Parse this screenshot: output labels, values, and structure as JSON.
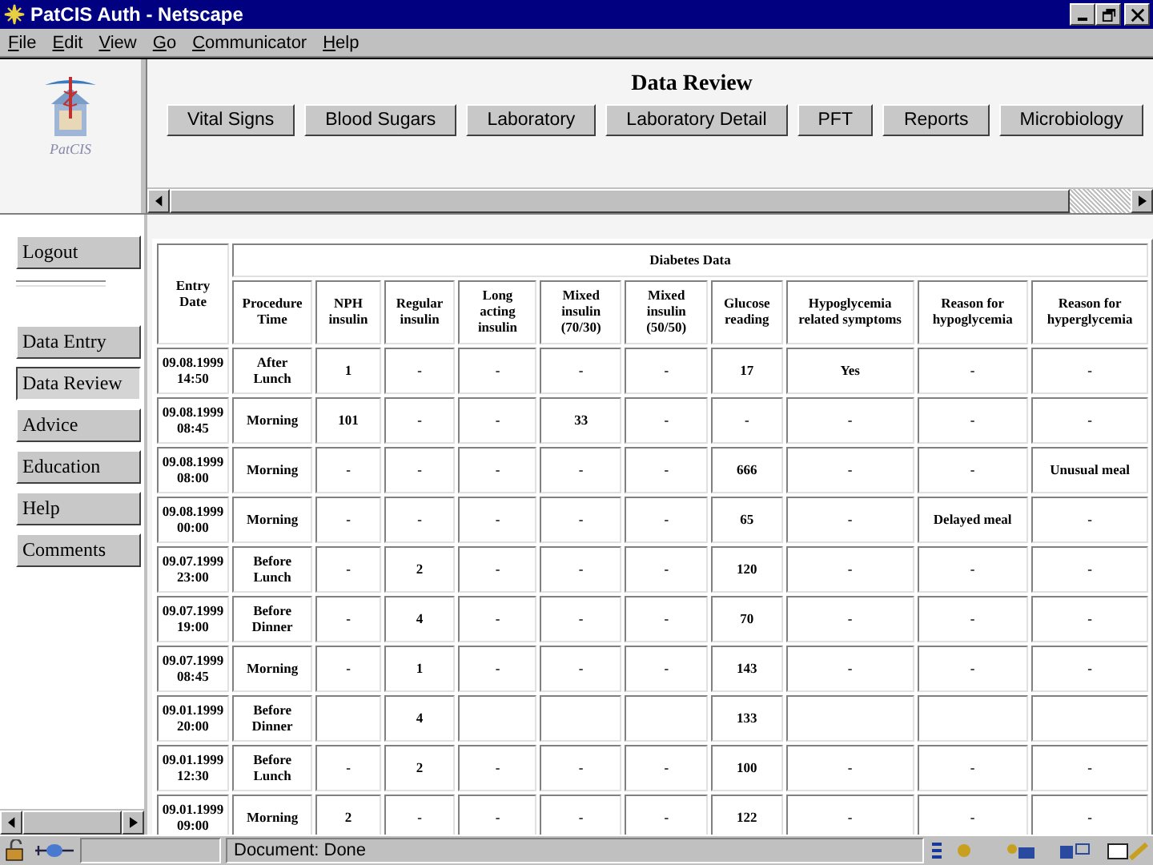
{
  "window": {
    "title": "PatCIS Auth - Netscape"
  },
  "menu": [
    "File",
    "Edit",
    "View",
    "Go",
    "Communicator",
    "Help"
  ],
  "logo": {
    "text": "PatCIS"
  },
  "header": {
    "title": "Data Review",
    "nav_buttons": [
      "Vital Signs",
      "Blood Sugars",
      "Laboratory",
      "Laboratory Detail",
      "PFT",
      "Reports",
      "Microbiology"
    ]
  },
  "sidebar": {
    "top_button": "Logout",
    "items": [
      {
        "label": "Data Entry",
        "selected": false
      },
      {
        "label": "Data Review",
        "selected": true
      },
      {
        "label": "Advice",
        "selected": false
      },
      {
        "label": "Education",
        "selected": false
      },
      {
        "label": "Help",
        "selected": false
      },
      {
        "label": "Comments",
        "selected": false
      }
    ]
  },
  "table": {
    "first_column": "Entry Date",
    "group_heading": "Diabetes Data",
    "columns": [
      "Procedure Time",
      "NPH insulin",
      "Regular insulin",
      "Long acting insulin",
      "Mixed insulin (70/30)",
      "Mixed insulin (50/50)",
      "Glucose reading",
      "Hypoglycemia related symptoms",
      "Reason for hypoglycemia",
      "Reason for hyperglycemia"
    ],
    "rows": [
      {
        "date": "09.08.1999",
        "time": "14:50",
        "cells": [
          "After Lunch",
          "1",
          "-",
          "-",
          "-",
          "-",
          "17",
          "Yes",
          "-",
          "-"
        ]
      },
      {
        "date": "09.08.1999",
        "time": "08:45",
        "cells": [
          "Morning",
          "101",
          "-",
          "-",
          "33",
          "-",
          "-",
          "-",
          "-",
          "-"
        ]
      },
      {
        "date": "09.08.1999",
        "time": "08:00",
        "cells": [
          "Morning",
          "-",
          "-",
          "-",
          "-",
          "-",
          "666",
          "-",
          "-",
          "Unusual meal"
        ]
      },
      {
        "date": "09.08.1999",
        "time": "00:00",
        "cells": [
          "Morning",
          "-",
          "-",
          "-",
          "-",
          "-",
          "65",
          "-",
          "Delayed meal",
          "-"
        ]
      },
      {
        "date": "09.07.1999",
        "time": "23:00",
        "cells": [
          "Before Lunch",
          "-",
          "2",
          "-",
          "-",
          "-",
          "120",
          "-",
          "-",
          "-"
        ]
      },
      {
        "date": "09.07.1999",
        "time": "19:00",
        "cells": [
          "Before Dinner",
          "-",
          "4",
          "-",
          "-",
          "-",
          "70",
          "-",
          "-",
          "-"
        ]
      },
      {
        "date": "09.07.1999",
        "time": "08:45",
        "cells": [
          "Morning",
          "-",
          "1",
          "-",
          "-",
          "-",
          "143",
          "-",
          "-",
          "-"
        ]
      },
      {
        "date": "09.01.1999",
        "time": "20:00",
        "cells": [
          "Before Dinner",
          "",
          "4",
          "",
          "",
          "",
          "133",
          "",
          "",
          ""
        ]
      },
      {
        "date": "09.01.1999",
        "time": "12:30",
        "cells": [
          "Before Lunch",
          "-",
          "2",
          "-",
          "-",
          "-",
          "100",
          "-",
          "-",
          "-"
        ]
      },
      {
        "date": "09.01.1999",
        "time": "09:00",
        "cells": [
          "Morning",
          "2",
          "-",
          "-",
          "-",
          "-",
          "122",
          "-",
          "-",
          "-"
        ]
      }
    ]
  },
  "status_bar": {
    "text": "Document: Done"
  }
}
